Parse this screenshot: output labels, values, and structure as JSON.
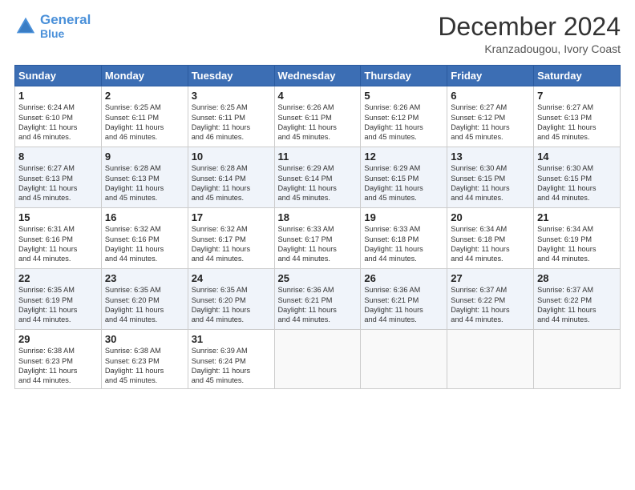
{
  "header": {
    "logo_line1": "General",
    "logo_line2": "Blue",
    "month": "December 2024",
    "location": "Kranzadougou, Ivory Coast"
  },
  "weekdays": [
    "Sunday",
    "Monday",
    "Tuesday",
    "Wednesday",
    "Thursday",
    "Friday",
    "Saturday"
  ],
  "weeks": [
    [
      {
        "day": "1",
        "text": "Sunrise: 6:24 AM\nSunset: 6:10 PM\nDaylight: 11 hours\nand 46 minutes."
      },
      {
        "day": "2",
        "text": "Sunrise: 6:25 AM\nSunset: 6:11 PM\nDaylight: 11 hours\nand 46 minutes."
      },
      {
        "day": "3",
        "text": "Sunrise: 6:25 AM\nSunset: 6:11 PM\nDaylight: 11 hours\nand 46 minutes."
      },
      {
        "day": "4",
        "text": "Sunrise: 6:26 AM\nSunset: 6:11 PM\nDaylight: 11 hours\nand 45 minutes."
      },
      {
        "day": "5",
        "text": "Sunrise: 6:26 AM\nSunset: 6:12 PM\nDaylight: 11 hours\nand 45 minutes."
      },
      {
        "day": "6",
        "text": "Sunrise: 6:27 AM\nSunset: 6:12 PM\nDaylight: 11 hours\nand 45 minutes."
      },
      {
        "day": "7",
        "text": "Sunrise: 6:27 AM\nSunset: 6:13 PM\nDaylight: 11 hours\nand 45 minutes."
      }
    ],
    [
      {
        "day": "8",
        "text": "Sunrise: 6:27 AM\nSunset: 6:13 PM\nDaylight: 11 hours\nand 45 minutes."
      },
      {
        "day": "9",
        "text": "Sunrise: 6:28 AM\nSunset: 6:13 PM\nDaylight: 11 hours\nand 45 minutes."
      },
      {
        "day": "10",
        "text": "Sunrise: 6:28 AM\nSunset: 6:14 PM\nDaylight: 11 hours\nand 45 minutes."
      },
      {
        "day": "11",
        "text": "Sunrise: 6:29 AM\nSunset: 6:14 PM\nDaylight: 11 hours\nand 45 minutes."
      },
      {
        "day": "12",
        "text": "Sunrise: 6:29 AM\nSunset: 6:15 PM\nDaylight: 11 hours\nand 45 minutes."
      },
      {
        "day": "13",
        "text": "Sunrise: 6:30 AM\nSunset: 6:15 PM\nDaylight: 11 hours\nand 44 minutes."
      },
      {
        "day": "14",
        "text": "Sunrise: 6:30 AM\nSunset: 6:15 PM\nDaylight: 11 hours\nand 44 minutes."
      }
    ],
    [
      {
        "day": "15",
        "text": "Sunrise: 6:31 AM\nSunset: 6:16 PM\nDaylight: 11 hours\nand 44 minutes."
      },
      {
        "day": "16",
        "text": "Sunrise: 6:32 AM\nSunset: 6:16 PM\nDaylight: 11 hours\nand 44 minutes."
      },
      {
        "day": "17",
        "text": "Sunrise: 6:32 AM\nSunset: 6:17 PM\nDaylight: 11 hours\nand 44 minutes."
      },
      {
        "day": "18",
        "text": "Sunrise: 6:33 AM\nSunset: 6:17 PM\nDaylight: 11 hours\nand 44 minutes."
      },
      {
        "day": "19",
        "text": "Sunrise: 6:33 AM\nSunset: 6:18 PM\nDaylight: 11 hours\nand 44 minutes."
      },
      {
        "day": "20",
        "text": "Sunrise: 6:34 AM\nSunset: 6:18 PM\nDaylight: 11 hours\nand 44 minutes."
      },
      {
        "day": "21",
        "text": "Sunrise: 6:34 AM\nSunset: 6:19 PM\nDaylight: 11 hours\nand 44 minutes."
      }
    ],
    [
      {
        "day": "22",
        "text": "Sunrise: 6:35 AM\nSunset: 6:19 PM\nDaylight: 11 hours\nand 44 minutes."
      },
      {
        "day": "23",
        "text": "Sunrise: 6:35 AM\nSunset: 6:20 PM\nDaylight: 11 hours\nand 44 minutes."
      },
      {
        "day": "24",
        "text": "Sunrise: 6:35 AM\nSunset: 6:20 PM\nDaylight: 11 hours\nand 44 minutes."
      },
      {
        "day": "25",
        "text": "Sunrise: 6:36 AM\nSunset: 6:21 PM\nDaylight: 11 hours\nand 44 minutes."
      },
      {
        "day": "26",
        "text": "Sunrise: 6:36 AM\nSunset: 6:21 PM\nDaylight: 11 hours\nand 44 minutes."
      },
      {
        "day": "27",
        "text": "Sunrise: 6:37 AM\nSunset: 6:22 PM\nDaylight: 11 hours\nand 44 minutes."
      },
      {
        "day": "28",
        "text": "Sunrise: 6:37 AM\nSunset: 6:22 PM\nDaylight: 11 hours\nand 44 minutes."
      }
    ],
    [
      {
        "day": "29",
        "text": "Sunrise: 6:38 AM\nSunset: 6:23 PM\nDaylight: 11 hours\nand 44 minutes."
      },
      {
        "day": "30",
        "text": "Sunrise: 6:38 AM\nSunset: 6:23 PM\nDaylight: 11 hours\nand 45 minutes."
      },
      {
        "day": "31",
        "text": "Sunrise: 6:39 AM\nSunset: 6:24 PM\nDaylight: 11 hours\nand 45 minutes."
      },
      {
        "day": "",
        "text": ""
      },
      {
        "day": "",
        "text": ""
      },
      {
        "day": "",
        "text": ""
      },
      {
        "day": "",
        "text": ""
      }
    ]
  ]
}
